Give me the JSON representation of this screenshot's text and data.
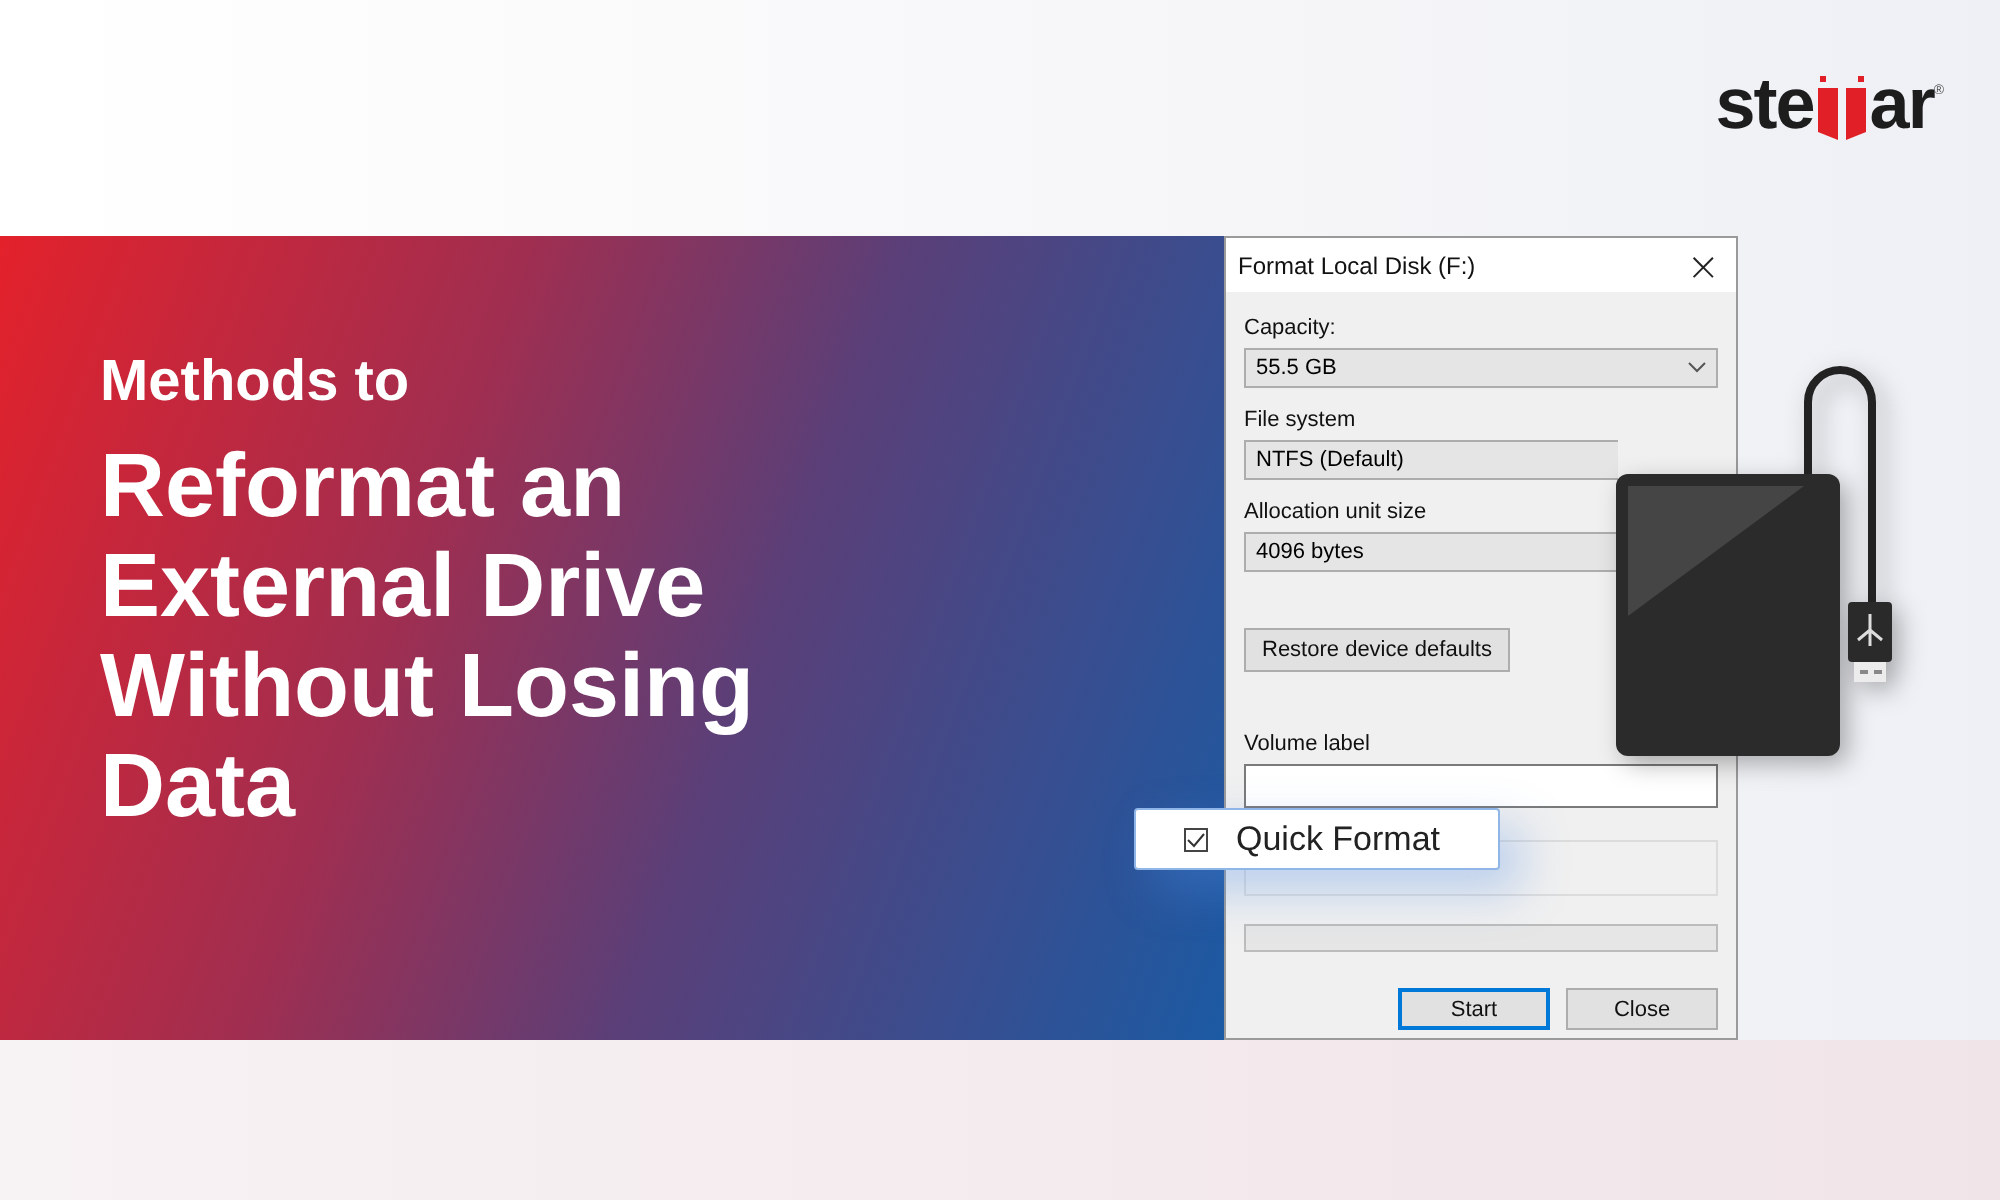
{
  "logo": {
    "left": "ste",
    "right": "ar",
    "mark": "®"
  },
  "hero": {
    "kicker": "Methods to",
    "title_lines": [
      "Reformat an",
      "External Drive",
      "Without Losing",
      "Data"
    ]
  },
  "dialog": {
    "title": "Format Local Disk (F:)",
    "close": "×",
    "fields": [
      {
        "kind": "dropdown",
        "label": "Capacity:",
        "value": "55.5 GB"
      },
      {
        "kind": "dropdown",
        "label": "File system",
        "value": "NTFS (Default)"
      },
      {
        "kind": "dropdown",
        "label": "Allocation unit size",
        "value": "4096 bytes"
      },
      {
        "kind": "button",
        "label": "Restore device defaults"
      },
      {
        "kind": "input",
        "label": "Volume label"
      }
    ],
    "quick_format": {
      "label": "Quick Format",
      "checked": true
    },
    "progress": {
      "level": 0
    },
    "buttons": [
      {
        "label": "Start",
        "selected": true
      },
      {
        "label": "Close",
        "selected": false
      }
    ]
  }
}
